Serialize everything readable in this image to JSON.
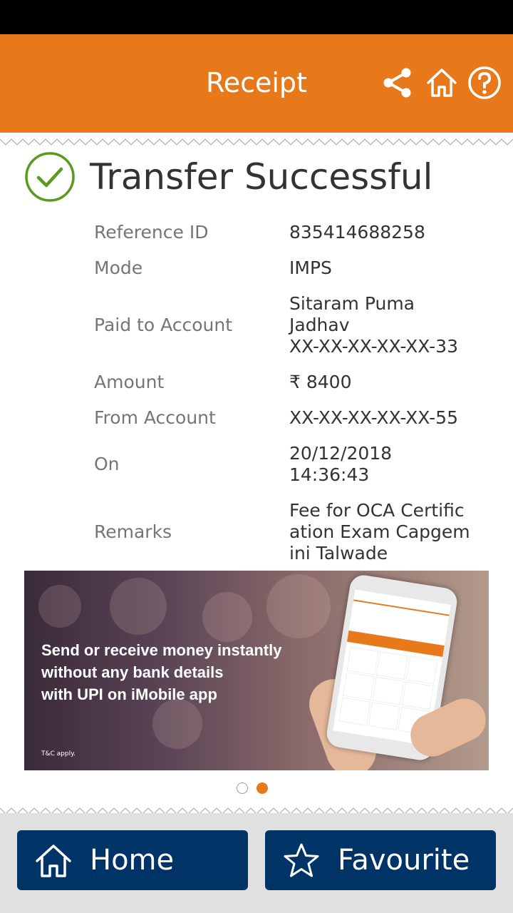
{
  "header": {
    "title": "Receipt",
    "icons": [
      "share-icon",
      "home-icon",
      "help-icon"
    ]
  },
  "status": {
    "title": "Transfer Successful",
    "icon": "check-circle-icon",
    "color": "#5b9a1f"
  },
  "details": [
    {
      "label": "Reference ID",
      "value": "835414688258"
    },
    {
      "label": "Mode",
      "value": "IMPS"
    },
    {
      "label": "Paid to Account",
      "value_lines": [
        "Sitaram Puma",
        "Jadhav",
        "XX-XX-XX-XX-XX-33"
      ]
    },
    {
      "label": "Amount",
      "value": "₹ 8400"
    },
    {
      "label": "From Account",
      "value": "XX-XX-XX-XX-XX-55"
    },
    {
      "label": "On",
      "value_lines": [
        "20/12/2018",
        "14:36:43"
      ]
    },
    {
      "label": "Remarks",
      "value_lines": [
        "Fee for OCA Certific",
        "ation Exam Capgem",
        "ini Talwade"
      ]
    }
  ],
  "banner": {
    "lines": [
      "Send or receive money instantly",
      "without any bank details",
      "with UPI on iMobile app"
    ],
    "note": "T&C apply."
  },
  "carousel": {
    "count": 2,
    "active": 2
  },
  "footer": {
    "home_label": "Home",
    "favourite_label": "Favourite"
  },
  "colors": {
    "accent": "#e8791b",
    "button": "#003366",
    "success": "#5b9a1f"
  }
}
